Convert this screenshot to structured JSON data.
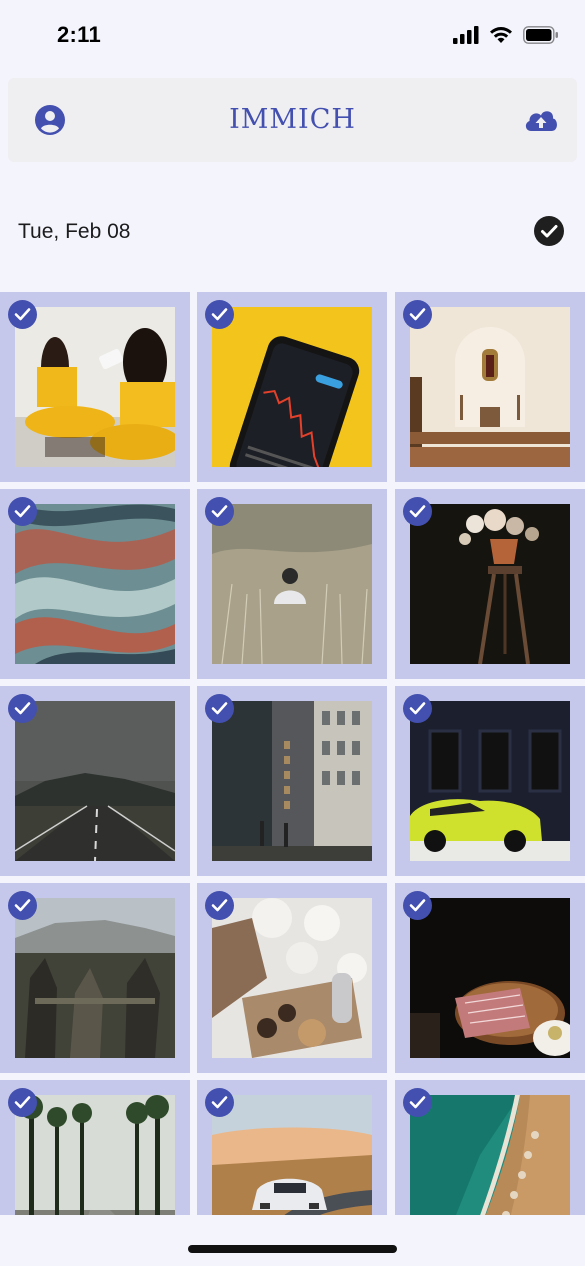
{
  "status": {
    "time": "2:11",
    "icons": [
      "signal-icon",
      "wifi-icon",
      "battery-icon"
    ]
  },
  "app_bar": {
    "title": "IMMICH",
    "left_icon": "account-circle-icon",
    "right_icon": "cloud-upload-icon"
  },
  "section": {
    "date": "Tue, Feb 08",
    "select_all_icon": "check-circle-icon"
  },
  "colors": {
    "accent": "#4350af",
    "tile_selected_bg": "#c5c8ea",
    "background": "#f4f5fc",
    "app_bar_bg": "#efeff2"
  },
  "photos": [
    {
      "name": "women-fitness-drinking",
      "selected": true
    },
    {
      "name": "phone-stock-chart-yellow",
      "selected": true
    },
    {
      "name": "chapel-interior",
      "selected": true
    },
    {
      "name": "abstract-marble-swirl",
      "selected": true
    },
    {
      "name": "person-in-tall-grass",
      "selected": true
    },
    {
      "name": "flowers-on-stool",
      "selected": true
    },
    {
      "name": "road-stormy-sky",
      "selected": true
    },
    {
      "name": "aura-building-street",
      "selected": true
    },
    {
      "name": "yellow-green-sports-car",
      "selected": true
    },
    {
      "name": "rocky-canyon-landscape",
      "selected": true
    },
    {
      "name": "cozy-coffee-cookies",
      "selected": true
    },
    {
      "name": "raw-meat-plate",
      "selected": true
    },
    {
      "name": "palm-tree-avenue",
      "selected": true
    },
    {
      "name": "white-car-on-road",
      "selected": true
    },
    {
      "name": "aerial-turquoise-coast",
      "selected": true
    }
  ]
}
